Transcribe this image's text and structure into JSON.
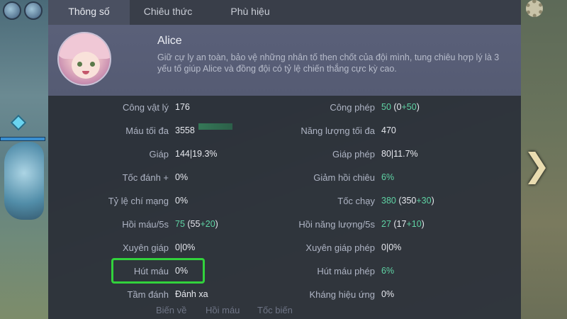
{
  "tabs": [
    {
      "label": "Thông số",
      "active": true
    },
    {
      "label": "Chiêu thức",
      "active": false
    },
    {
      "label": "Phù hiệu",
      "active": false
    }
  ],
  "hero": {
    "name": "Alice",
    "description": "Giữ cự ly an toàn, bảo vệ những nhân tố then chốt của đội mình, tung chiêu hợp lý là 3 yếu tố giúp Alice và đồng đội có tỷ lệ chiến thắng cực kỳ cao."
  },
  "stats_left": [
    {
      "label": "Công vật lý",
      "value": "176"
    },
    {
      "label": "Máu tối đa",
      "value": "3558"
    },
    {
      "label": "Giáp",
      "value": "144|19.3%"
    },
    {
      "label": "Tốc đánh +",
      "value": "0%"
    },
    {
      "label": "Tỷ lệ chí mạng",
      "value": "0%"
    },
    {
      "label": "Hồi máu/5s",
      "value_main": "75",
      "value_open": " (55",
      "value_bonus": "+20",
      "value_close": ")"
    },
    {
      "label": "Xuyên giáp",
      "value": "0|0%"
    },
    {
      "label": "Hút máu",
      "value": "0%"
    },
    {
      "label": "Tầm đánh",
      "value": "Đánh xa"
    }
  ],
  "stats_right": [
    {
      "label": "Công phép",
      "value_main": "50",
      "value_open": " (0",
      "value_bonus": "+50",
      "value_close": ")"
    },
    {
      "label": "Năng lượng tối đa",
      "value": "470"
    },
    {
      "label": "Giáp phép",
      "value": "80|11.7%"
    },
    {
      "label": "Giảm hồi chiêu",
      "value": "6%"
    },
    {
      "label": "Tốc chạy",
      "value_main": "380",
      "value_open": " (350",
      "value_bonus": "+30",
      "value_close": ")"
    },
    {
      "label": "Hồi năng lượng/5s",
      "value_main": "27",
      "value_open": " (17",
      "value_bonus": "+10",
      "value_close": ")"
    },
    {
      "label": "Xuyên giáp phép",
      "value": "0|0%"
    },
    {
      "label": "Hút máu phép",
      "value": "6%"
    },
    {
      "label": "Kháng hiệu ứng",
      "value": "0%"
    }
  ],
  "bottom_skills": [
    "Biến về",
    "Hồi máu",
    "Tốc biến"
  ],
  "colors": {
    "highlight": "#32d23c",
    "bonus_green": "#5fd3a4",
    "panel": "#2c303a"
  }
}
